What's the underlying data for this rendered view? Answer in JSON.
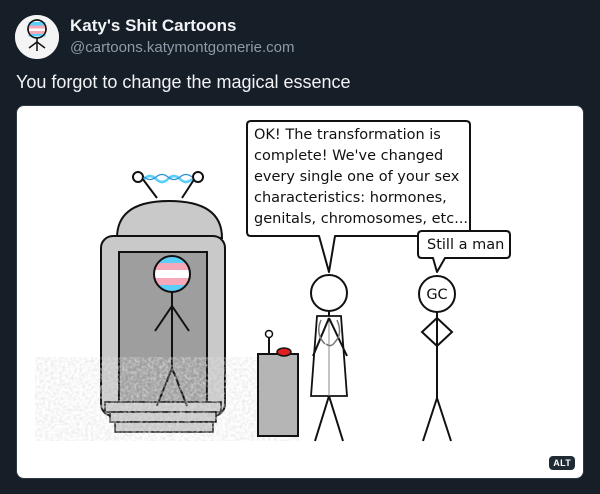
{
  "author": {
    "name": "Katy's Shit Cartoons",
    "handle": "@cartoons.katymontgomerie.com"
  },
  "post": {
    "text": "You forgot to change the magical essence"
  },
  "comic": {
    "doctor_speech": [
      "OK! The transformation is",
      "complete! We've changed",
      "every single one of your sex",
      "characteristics: hormones,",
      "genitals, chromosomes, etc..."
    ],
    "gc_speech": "Still a man",
    "gc_label": "GC"
  },
  "image": {
    "alt_badge": "ALT"
  },
  "colors": {
    "background": "#161e27",
    "trans_blue": "#5bcefa",
    "trans_pink": "#f5a9b8",
    "trans_white": "#ffffff",
    "machine_gray": "#c9c9c9",
    "button_red": "#e02020"
  }
}
